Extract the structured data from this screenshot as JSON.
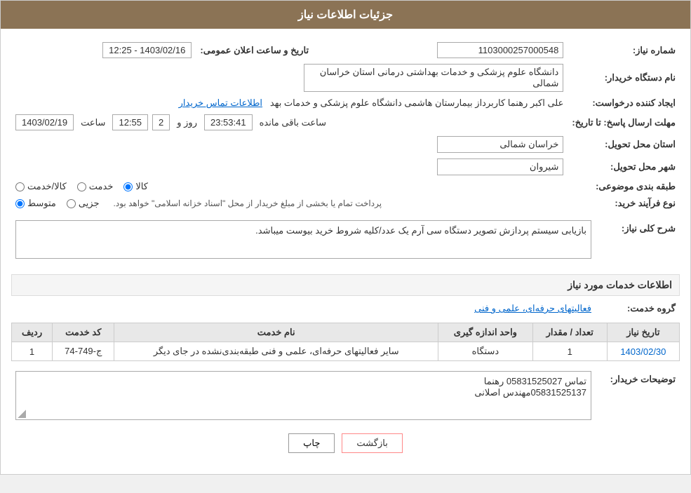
{
  "header": {
    "title": "جزئیات اطلاعات نیاز"
  },
  "fields": {
    "need_number_label": "شماره نیاز:",
    "need_number_value": "1103000257000548",
    "announce_date_label": "تاریخ و ساعت اعلان عمومی:",
    "announce_date_value": "1403/02/16 - 12:25",
    "buyer_org_label": "نام دستگاه خریدار:",
    "buyer_org_value": "دانشگاه علوم پزشکی و خدمات بهداشتی درمانی استان خراسان شمالی",
    "creator_label": "ایجاد کننده درخواست:",
    "creator_value": "علی اکبر رهنما کاربرداز بیمارستان هاشمی دانشگاه علوم پزشکی و خدمات بهد",
    "creator_link": "اطلاعات تماس خریدار",
    "deadline_label": "مهلت ارسال پاسخ: تا تاریخ:",
    "deadline_date": "1403/02/19",
    "deadline_time_label": "ساعت",
    "deadline_time": "12:55",
    "deadline_days_label": "روز و",
    "deadline_days": "2",
    "deadline_remaining_label": "ساعت باقی مانده",
    "deadline_remaining": "23:53:41",
    "province_label": "استان محل تحویل:",
    "province_value": "خراسان شمالی",
    "city_label": "شهر محل تحویل:",
    "city_value": "شیروان",
    "category_label": "طبقه بندی موضوعی:",
    "category_options": [
      "کالا",
      "خدمت",
      "کالا/خدمت"
    ],
    "category_selected": "کالا",
    "purchase_type_label": "نوع فرآیند خرید:",
    "purchase_type_options": [
      "جزیی",
      "متوسط"
    ],
    "purchase_type_selected": "متوسط",
    "purchase_type_note": "پرداخت تمام یا بخشی از مبلغ خریدار از محل \"اسناد خزانه اسلامی\" خواهد بود.",
    "need_desc_label": "شرح کلی نیاز:",
    "need_desc_value": "بازیابی سیستم پردازش تصویر دستگاه سی آرم یک عدد/کلیه شروط خرید بیوست میباشد.",
    "services_header": "اطلاعات خدمات مورد نیاز",
    "service_group_label": "گروه خدمت:",
    "service_group_value": "فعالیتهای حرفه‌ای، علمی و فنی",
    "table": {
      "col_row": "ردیف",
      "col_code": "کد خدمت",
      "col_name": "نام خدمت",
      "col_unit": "واحد اندازه گیری",
      "col_qty": "تعداد / مقدار",
      "col_date": "تاریخ نیاز",
      "rows": [
        {
          "row": "1",
          "code": "ج-749-74",
          "name": "سایر فعالیتهای حرفه‌ای، علمی و فنی طبقه‌بندی‌نشده در جای دیگر",
          "unit": "دستگاه",
          "qty": "1",
          "date": "1403/02/30"
        }
      ]
    },
    "buyer_notes_label": "توضیحات خریدار:",
    "buyer_notes_value": "تماس 05831525027 رهنما\n05831525137مهندس اصلانی"
  },
  "buttons": {
    "print": "چاپ",
    "back": "بازگشت"
  }
}
